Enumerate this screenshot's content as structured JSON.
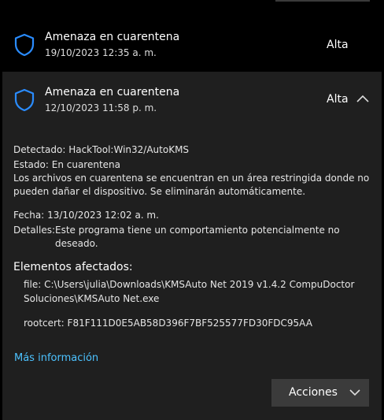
{
  "threats": [
    {
      "title": "Amenaza en cuarentena",
      "date": "19/10/2023 12:35 a. m.",
      "severity": "Alta",
      "icon": "shield-icon"
    },
    {
      "title": "Amenaza en cuarentena",
      "date": "12/10/2023 11:58 p. m.",
      "severity": "Alta",
      "icon": "shield-icon",
      "expanded": true
    }
  ],
  "details": {
    "detected_label": "Detectado:",
    "detected_value": "HackTool:Win32/AutoKMS",
    "status_label": "Estado:",
    "status_value": "En cuarentena",
    "quarantine_line1": "Los archivos en cuarentena se encuentran en un área restringida donde no",
    "quarantine_line2": "pueden dañar el dispositivo. Se eliminarán automáticamente.",
    "date_label": "Fecha:",
    "date_value": "13/10/2023 12:02 a. m.",
    "details_label": "Detalles:",
    "details_line1": "Este programa tiene un comportamiento potencialmente no",
    "details_line2": "deseado."
  },
  "affected": {
    "title": "Elementos afectados:",
    "file_line1": "file: C:\\Users\\julia\\Downloads\\KMSAuto Net 2019 v1.4.2 CompuDoctor",
    "file_line2": "Soluciones\\KMSAuto Net.exe",
    "rootcert": "rootcert: F81F111D0E5AB58D396F7BF525577FD30FDC95AA"
  },
  "more_info_link": "Más información",
  "actions_button": "Acciones",
  "colors": {
    "accent": "#1e90ff",
    "link": "#4cc2ff",
    "panel": "#1f1f1f",
    "button": "#3b3b3b"
  }
}
